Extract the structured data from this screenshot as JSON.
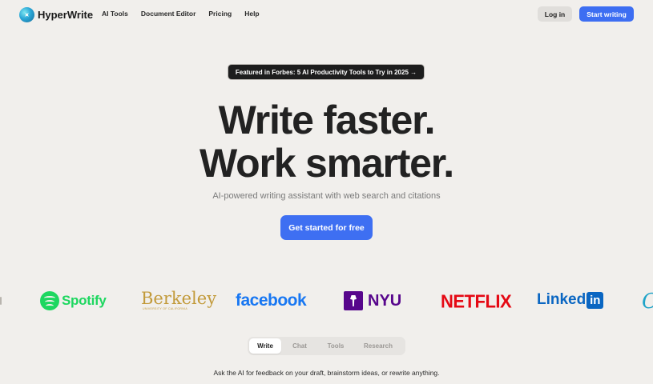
{
  "brand": {
    "name": "HyperWrite",
    "logo": "hyperwrite-logo"
  },
  "nav": {
    "links": [
      "AI Tools",
      "Document Editor",
      "Pricing",
      "Help"
    ],
    "login": "Log in",
    "start": "Start writing"
  },
  "hero": {
    "featured": "Featured in Forbes: 5 AI Productivity Tools to Try in 2025 →",
    "line1": "Write faster.",
    "line2": "Work smarter.",
    "subtitle": "AI-powered writing assistant with web search and citations",
    "cta": "Get started for free"
  },
  "logos": {
    "spotify": "Spotify",
    "berkeley": "Berkeley",
    "berkeley_sub": "UNIVERSITY OF CALIFORNIA",
    "facebook": "facebook",
    "nyu": "NYU",
    "netflix": "NETFLIX",
    "linkedin_text": "Linked",
    "linkedin_box": "in",
    "partial": "C"
  },
  "tabs": {
    "items": [
      "Write",
      "Chat",
      "Tools",
      "Research"
    ],
    "active": "Write",
    "caption": "Ask the AI for feedback on your draft, brainstorm ideas, or rewrite anything."
  },
  "colors": {
    "background": "#f1efec",
    "accent": "#3d6ef2",
    "spotify": "#1ed760",
    "berkeley": "#c29a3a",
    "facebook": "#1877f2",
    "nyu": "#57068c",
    "netflix": "#e50914",
    "linkedin": "#0a66c2"
  }
}
